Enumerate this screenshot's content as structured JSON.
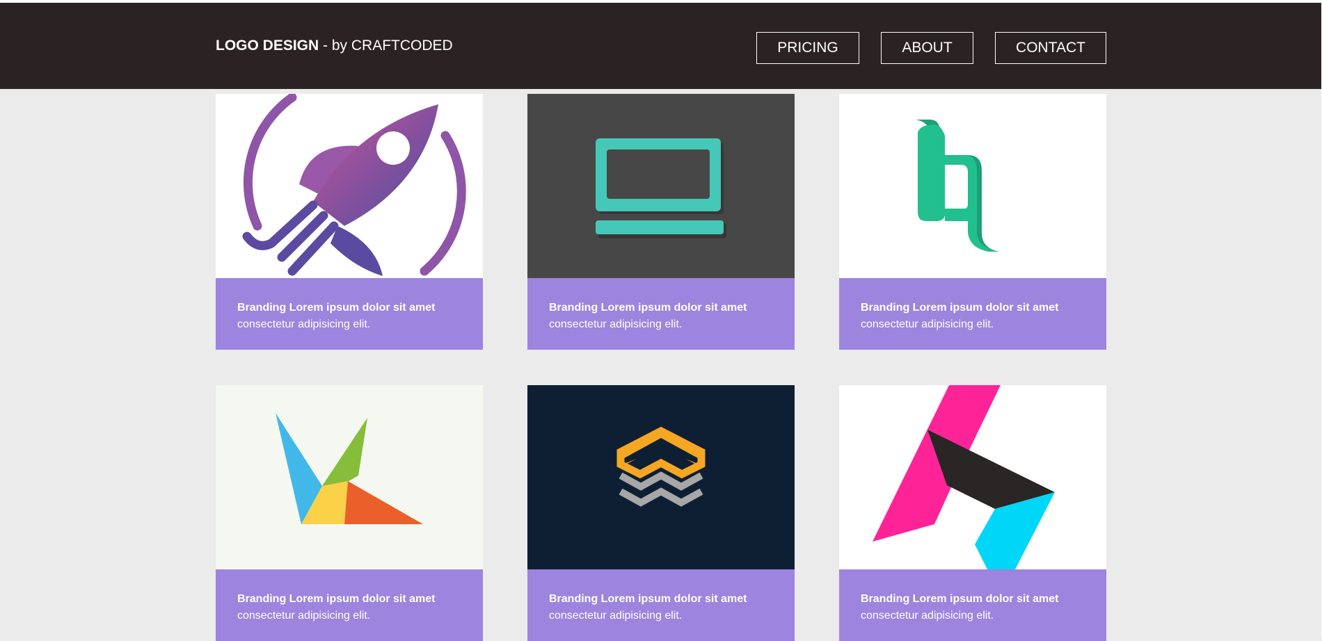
{
  "header": {
    "brand_bold": "LOGO DESIGN",
    "brand_rest": " - by CRAFTCODED",
    "nav": [
      "PRICING",
      "ABOUT",
      "CONTACT"
    ]
  },
  "cards": [
    {
      "title": "Branding Lorem ipsum dolor sit amet",
      "desc": "consectetur adipisicing elit.",
      "logo": "rocket-logo",
      "bg": "#ffffff"
    },
    {
      "title": "Branding Lorem ipsum dolor sit amet",
      "desc": "consectetur adipisicing elit.",
      "logo": "laptop-logo",
      "bg": "#474747"
    },
    {
      "title": "Branding Lorem ipsum dolor sit amet",
      "desc": "consectetur adipisicing elit.",
      "logo": "bq-ribbon-logo",
      "bg": "#ffffff"
    },
    {
      "title": "Branding Lorem ipsum dolor sit amet",
      "desc": "consectetur adipisicing elit.",
      "logo": "bird-geometric-logo",
      "bg": "#f5f8f0"
    },
    {
      "title": "Branding Lorem ipsum dolor sit amet",
      "desc": "consectetur adipisicing elit.",
      "logo": "stacked-chevrons-logo",
      "bg": "#0f1f33"
    },
    {
      "title": "Branding Lorem ipsum dolor sit amet",
      "desc": "consectetur adipisicing elit.",
      "logo": "abstract-h-logo",
      "bg": "#ffffff"
    }
  ],
  "colors": {
    "header_bg": "#2b2323",
    "page_bg": "#ebebeb",
    "caption_bg": "#9d84de",
    "text_light": "#ffffff"
  }
}
